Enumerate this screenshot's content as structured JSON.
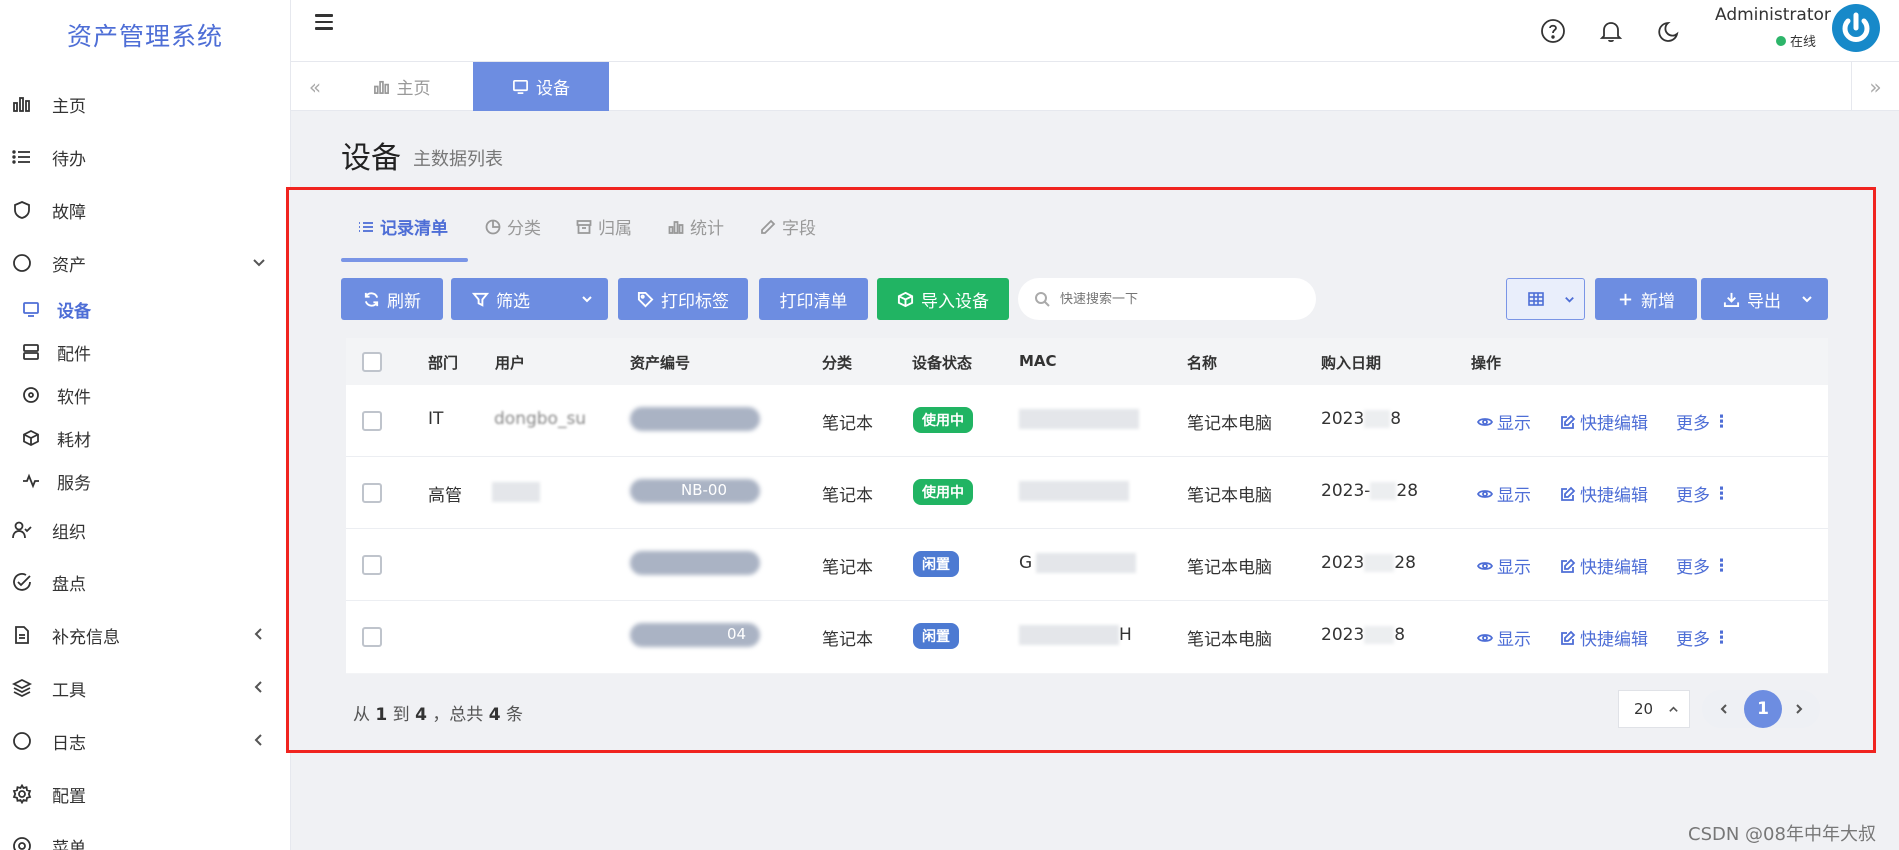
{
  "app": {
    "brand": "资产管理系统"
  },
  "sidebar": {
    "items": [
      {
        "label": "主页"
      },
      {
        "label": "待办"
      },
      {
        "label": "故障"
      },
      {
        "label": "资产"
      },
      {
        "label": "组织"
      },
      {
        "label": "盘点"
      },
      {
        "label": "补充信息"
      },
      {
        "label": "工具"
      },
      {
        "label": "日志"
      },
      {
        "label": "配置"
      },
      {
        "label": "菜单"
      }
    ],
    "asset_sub": [
      {
        "label": "设备"
      },
      {
        "label": "配件"
      },
      {
        "label": "软件"
      },
      {
        "label": "耗材"
      },
      {
        "label": "服务"
      }
    ]
  },
  "header": {
    "user_name": "Administrator",
    "user_status": "在线"
  },
  "tabs": [
    {
      "label": "主页"
    },
    {
      "label": "设备"
    }
  ],
  "page": {
    "title": "设备",
    "subtitle": "主数据列表"
  },
  "content_tabs": [
    {
      "label": "记录清单"
    },
    {
      "label": "分类"
    },
    {
      "label": "归属"
    },
    {
      "label": "统计"
    },
    {
      "label": "字段"
    }
  ],
  "toolbar": {
    "refresh": "刷新",
    "filter": "筛选",
    "print_label": "打印标签",
    "print_list": "打印清单",
    "import": "导入设备",
    "search_placeholder": "快速搜索一下",
    "add": "新增",
    "export": "导出"
  },
  "table": {
    "columns": [
      "部门",
      "用户",
      "资产编号",
      "分类",
      "设备状态",
      "MAC",
      "名称",
      "购入日期",
      "操作"
    ],
    "rows": [
      {
        "dept": "IT",
        "user": "dongbo_su",
        "asset_no": "",
        "category": "笔记本",
        "status": "使用中",
        "mac": "",
        "name": "笔记本电脑",
        "date": "2023",
        "date_tail": "8"
      },
      {
        "dept": "高管",
        "user": "",
        "asset_no": "NB-00",
        "category": "笔记本",
        "status": "使用中",
        "mac": "",
        "name": "笔记本电脑",
        "date": "2023-",
        "date_tail": "28"
      },
      {
        "dept": "",
        "user": "",
        "asset_no": "",
        "category": "笔记本",
        "status": "闲置",
        "mac": "G",
        "name": "笔记本电脑",
        "date": "2023",
        "date_tail": "28"
      },
      {
        "dept": "",
        "user": "",
        "asset_no": "04",
        "category": "笔记本",
        "status": "闲置",
        "mac": "H",
        "name": "笔记本电脑",
        "date": "2023",
        "date_tail": "8"
      }
    ],
    "actions": {
      "show": "显示",
      "quick_edit": "快捷编辑",
      "more": "更多"
    }
  },
  "footer": {
    "from_label": "从",
    "from": "1",
    "to_label": "到",
    "to": "4",
    "total_label": "，总共",
    "total": "4",
    "unit": "条",
    "page_size": "20",
    "current_page": "1"
  },
  "watermark": "CSDN @08年中年大叔",
  "colors": {
    "accent": "#6d8de1",
    "brand": "#4e6ed6",
    "green": "#21b463",
    "highlight_border": "#f0231f"
  }
}
